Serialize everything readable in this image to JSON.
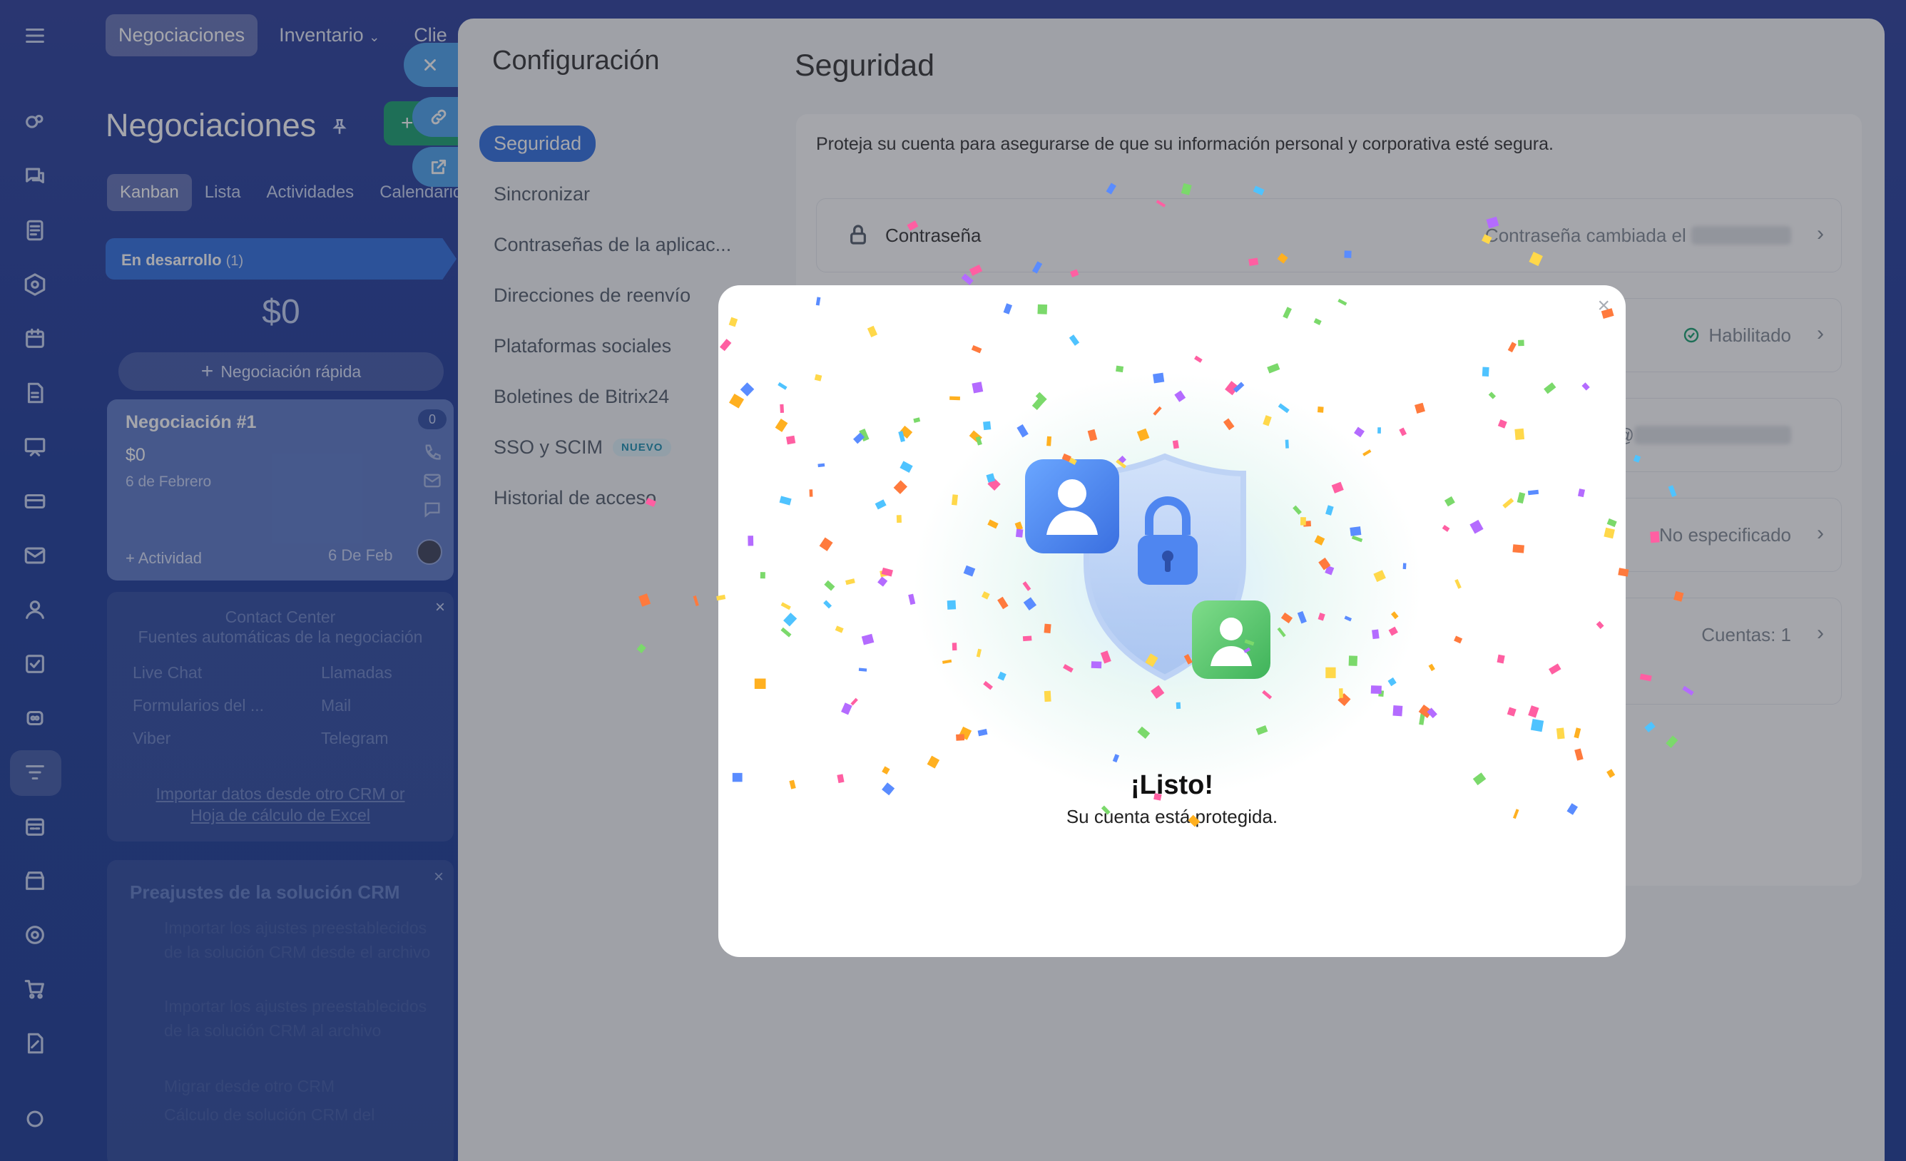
{
  "topnav": {
    "tabs": [
      {
        "label": "Negociaciones"
      },
      {
        "label": "Inventario"
      },
      {
        "label": "Clie"
      }
    ]
  },
  "crm": {
    "title": "Negociaciones",
    "view_tabs": [
      "Kanban",
      "Lista",
      "Actividades",
      "Calendario"
    ],
    "stage": {
      "name": "En desarrollo",
      "count": "(1)",
      "sum": "$0"
    },
    "quick_deal": "Negociación rápida",
    "deal": {
      "title": "Negociación #1",
      "amount": "$0",
      "date": "6 de Febrero",
      "badge": "0",
      "activity": "+ Actividad",
      "due": "6 De Feb"
    },
    "contact_center": {
      "title": "Contact Center",
      "subtitle": "Fuentes automáticas de la negociación",
      "items": [
        "Live Chat",
        "Llamadas",
        "Formularios del ...",
        "Mail",
        "Viber",
        "Telegram"
      ],
      "import_text": "Importar datos desde otro CRM or",
      "import_link": "Hoja de cálculo de Excel"
    },
    "presets": {
      "title": "Preajustes de la solución CRM",
      "items": [
        "Importar los ajustes preestablecidos de la solución CRM desde el archivo",
        "Importar los ajustes preestablecidos de la solución CRM al archivo",
        "Migrar desde otro CRM",
        "Cálculo de solución CRM del"
      ]
    }
  },
  "settings": {
    "title": "Configuración",
    "menu": [
      {
        "label": "Seguridad",
        "active": true
      },
      {
        "label": "Sincronizar"
      },
      {
        "label": "Contraseñas de la aplicac..."
      },
      {
        "label": "Direcciones de reenvío"
      },
      {
        "label": "Plataformas sociales"
      },
      {
        "label": "Boletines de Bitrix24"
      },
      {
        "label": "SSO y SCIM",
        "badge": "NUEVO"
      },
      {
        "label": "Historial de acceso"
      }
    ],
    "section_title": "Seguridad",
    "intro": "Proteja su cuenta para asegurarse de que su información personal y corporativa esté segura.",
    "rows": [
      {
        "label": "Contraseña",
        "value": "Contraseña cambiada el"
      },
      {
        "label": "",
        "value": "Habilitado"
      },
      {
        "label": "",
        "value": "@"
      },
      {
        "label": "",
        "value": "No especificado"
      },
      {
        "label": "",
        "value": "Cuentas: 1"
      }
    ]
  },
  "modal": {
    "title": "¡Listo!",
    "subtitle": "Su cuenta está protegida.",
    "close": "×"
  },
  "colors": {
    "accent": "#2f6fe0",
    "success": "#18a06f",
    "shield": "#a9c4f2"
  }
}
